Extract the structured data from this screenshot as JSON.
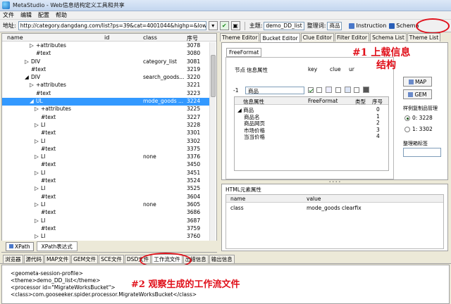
{
  "window": {
    "title": "MetaStudio - Web信息结构定义工具和共享"
  },
  "menu": [
    "文件",
    "编辑",
    "配置",
    "帮助"
  ],
  "toolbar": {
    "address_label": "地址:",
    "address": "http://category.dangdang.com/list?ps=39&cat=4001044&highp=&lowp",
    "theme_label": "主题:",
    "theme_value": "demo_DD_list",
    "theme_reg_label": "整理词:",
    "theme_reg_value": "商品",
    "instruction_label": "Instruction",
    "schema_label": "Schema"
  },
  "tree": {
    "columns": [
      "name",
      "id",
      "class",
      "序号"
    ],
    "rows": [
      {
        "name": "+attributes",
        "id": "",
        "cls": "",
        "n": "3078",
        "indent": 3,
        "exp": "▷",
        "sel": false
      },
      {
        "name": "#text",
        "id": "",
        "cls": "",
        "n": "3080",
        "indent": 3,
        "exp": "",
        "sel": false
      },
      {
        "name": "DIV",
        "id": "",
        "cls": "category_list",
        "n": "3081",
        "indent": 2,
        "exp": "▷",
        "sel": false
      },
      {
        "name": "#text",
        "id": "",
        "cls": "",
        "n": "3219",
        "indent": 2,
        "exp": "",
        "sel": false
      },
      {
        "name": "DIV",
        "id": "",
        "cls": "search_goods...",
        "n": "3220",
        "indent": 2,
        "exp": "◢",
        "sel": false
      },
      {
        "name": "+attributes",
        "id": "",
        "cls": "",
        "n": "3221",
        "indent": 3,
        "exp": "▷",
        "sel": false
      },
      {
        "name": "#text",
        "id": "",
        "cls": "",
        "n": "3223",
        "indent": 3,
        "exp": "",
        "sel": false
      },
      {
        "name": "UL",
        "id": "",
        "cls": "mode_goods ...",
        "n": "3224",
        "indent": 3,
        "exp": "◢",
        "sel": true
      },
      {
        "name": "+attributes",
        "id": "",
        "cls": "",
        "n": "3225",
        "indent": 4,
        "exp": "▷",
        "sel": false
      },
      {
        "name": "#text",
        "id": "",
        "cls": "",
        "n": "3227",
        "indent": 4,
        "exp": "",
        "sel": false
      },
      {
        "name": "LI",
        "id": "",
        "cls": "",
        "n": "3228",
        "indent": 4,
        "exp": "▷",
        "sel": false
      },
      {
        "name": "#text",
        "id": "",
        "cls": "",
        "n": "3301",
        "indent": 4,
        "exp": "",
        "sel": false
      },
      {
        "name": "LI",
        "id": "",
        "cls": "",
        "n": "3302",
        "indent": 4,
        "exp": "▷",
        "sel": false
      },
      {
        "name": "#text",
        "id": "",
        "cls": "",
        "n": "3375",
        "indent": 4,
        "exp": "",
        "sel": false
      },
      {
        "name": "LI",
        "id": "",
        "cls": "none",
        "n": "3376",
        "indent": 4,
        "exp": "▷",
        "sel": false
      },
      {
        "name": "#text",
        "id": "",
        "cls": "",
        "n": "3450",
        "indent": 4,
        "exp": "",
        "sel": false
      },
      {
        "name": "LI",
        "id": "",
        "cls": "",
        "n": "3451",
        "indent": 4,
        "exp": "▷",
        "sel": false
      },
      {
        "name": "#text",
        "id": "",
        "cls": "",
        "n": "3524",
        "indent": 4,
        "exp": "",
        "sel": false
      },
      {
        "name": "LI",
        "id": "",
        "cls": "",
        "n": "3525",
        "indent": 4,
        "exp": "▷",
        "sel": false
      },
      {
        "name": "#text",
        "id": "",
        "cls": "",
        "n": "3604",
        "indent": 4,
        "exp": "",
        "sel": false
      },
      {
        "name": "LI",
        "id": "",
        "cls": "none",
        "n": "3605",
        "indent": 4,
        "exp": "▷",
        "sel": false
      },
      {
        "name": "#text",
        "id": "",
        "cls": "",
        "n": "3686",
        "indent": 4,
        "exp": "",
        "sel": false
      },
      {
        "name": "LI",
        "id": "",
        "cls": "",
        "n": "3687",
        "indent": 4,
        "exp": "▷",
        "sel": false
      },
      {
        "name": "#text",
        "id": "",
        "cls": "",
        "n": "3759",
        "indent": 4,
        "exp": "",
        "sel": false
      },
      {
        "name": "LI",
        "id": "",
        "cls": "",
        "n": "3760",
        "indent": 4,
        "exp": "▷",
        "sel": false
      }
    ]
  },
  "xpath": {
    "button": "XPath",
    "tab": "XPath表达式"
  },
  "right_tabs": [
    "Theme Editor",
    "Bucket Editor",
    "Clue Editor",
    "Filter Editor",
    "Schema List",
    "Theme List"
  ],
  "freeformat": {
    "tab": "FreeFormat",
    "headers": [
      "节点",
      "信息属性",
      "key",
      "clue",
      "ur"
    ],
    "node_num": "-1",
    "node_value": "商品",
    "table_headers": [
      "信息属性",
      "FreeFormat",
      "类型",
      "序号"
    ],
    "table_rows": [
      {
        "name": "◢ 商品",
        "n": "0",
        "indent": 0
      },
      {
        "name": "商品名",
        "n": "1",
        "indent": 1
      },
      {
        "name": "商品网页",
        "n": "2",
        "indent": 1
      },
      {
        "name": "市场价格",
        "n": "3",
        "indent": 1
      },
      {
        "name": "当当价格",
        "n": "4",
        "indent": 1
      }
    ]
  },
  "side": {
    "map_btn": "MAP",
    "gem_btn": "GEM",
    "sample_label": "样例复制品管理",
    "radio0": "0: 3228",
    "radio1": "1: 3302",
    "tag_label": "整理箱标签"
  },
  "html_attr": {
    "caption": "HTML元素属性",
    "headers": [
      "name",
      "value"
    ],
    "row_name": "class",
    "row_value": "mode_goods clearfix"
  },
  "bottom_tabs": [
    "浏览器",
    "源代码",
    "MAP文件",
    "GEM文件",
    "SCE文件",
    "DSD文件",
    "工作流文件",
    "出错信息",
    "输出信息"
  ],
  "console": [
    "<geometa-session-profile>",
    "<theme>demo_DD_list</theme>",
    "<processor id=\"MigrateWorksBucket\">",
    "<class>com.gooseeker.spider.processor.MigrateWorksBucket</class>"
  ],
  "annotations": {
    "a1_line1": "#1  上载信息",
    "a1_line2": "结构",
    "a2": "#2  观察生成的工作流文件"
  }
}
